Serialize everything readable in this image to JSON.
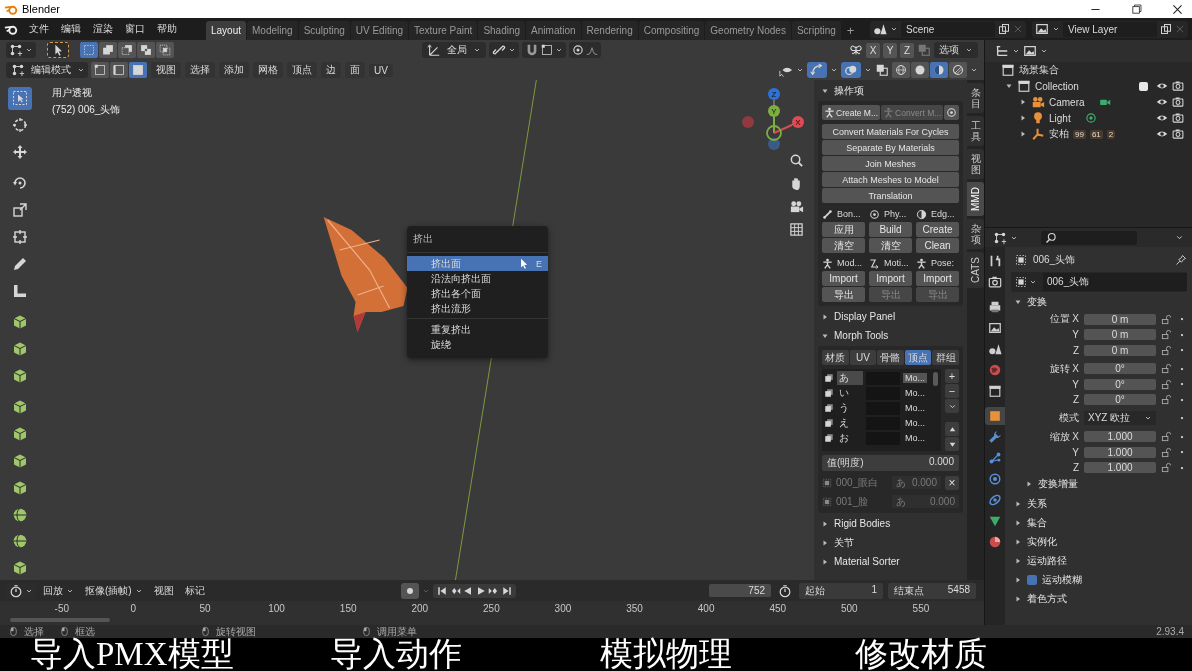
{
  "window": {
    "title": "Blender"
  },
  "menus": [
    "文件",
    "编辑",
    "渲染",
    "窗口",
    "帮助"
  ],
  "workspaces": [
    {
      "label": "Layout",
      "selected": true
    },
    {
      "label": "Modeling",
      "selected": false
    },
    {
      "label": "Sculpting",
      "selected": false
    },
    {
      "label": "UV Editing",
      "selected": false
    },
    {
      "label": "Texture Paint",
      "selected": false
    },
    {
      "label": "Shading",
      "selected": false
    },
    {
      "label": "Animation",
      "selected": false
    },
    {
      "label": "Rendering",
      "selected": false
    },
    {
      "label": "Compositing",
      "selected": false
    },
    {
      "label": "Geometry Nodes",
      "selected": false
    },
    {
      "label": "Scripting",
      "selected": false
    }
  ],
  "add_workspace": "+",
  "scene": "Scene",
  "view_layer": "View Layer",
  "viewport": {
    "select_set": [
      {
        "selected": true
      },
      {
        "selected": false
      },
      {
        "selected": false
      },
      {
        "selected": false
      },
      {
        "selected": false
      }
    ],
    "transform_orientation": "全局",
    "axes": [
      {
        "label": "X"
      },
      {
        "label": "Y"
      },
      {
        "label": "Z"
      }
    ],
    "options": "选项",
    "mode": "编辑模式",
    "select_modes": [
      {
        "selected": false
      },
      {
        "selected": false
      },
      {
        "selected": true
      }
    ],
    "menus": [
      "视图",
      "选择",
      "添加",
      "网格",
      "顶点",
      "边",
      "面",
      "UV"
    ],
    "shading": [
      {
        "selected": false
      },
      {
        "selected": false
      },
      {
        "selected": true
      },
      {
        "selected": false
      }
    ],
    "view_name": "用户透视",
    "object_info": "(752) 006_头饰",
    "gizmo": {
      "x": "X",
      "y": "Y",
      "z": "Z"
    }
  },
  "tools": [
    {
      "selected": true
    },
    {
      "selected": false
    },
    {
      "selected": false
    },
    {
      "selected": false
    },
    {
      "selected": false
    },
    {
      "selected": false
    },
    {
      "selected": false
    },
    {
      "selected": false
    },
    {
      "selected": false
    },
    {
      "selected": false
    },
    {
      "selected": false
    },
    {
      "selected": false
    },
    {
      "selected": false
    },
    {
      "selected": false
    },
    {
      "selected": false
    },
    {
      "selected": false
    },
    {
      "selected": false
    },
    {
      "selected": false
    }
  ],
  "context_menu": {
    "title": "挤出",
    "groups": [
      [
        {
          "label": "挤出面",
          "shortcut": "E",
          "selected": true
        },
        {
          "label": "沿法向挤出面",
          "selected": false
        },
        {
          "label": "挤出各个面",
          "selected": false
        },
        {
          "label": "挤出流形",
          "selected": false
        }
      ],
      [
        {
          "label": "重复挤出",
          "selected": false
        },
        {
          "label": "旋绕",
          "selected": false
        }
      ]
    ]
  },
  "sidebar": {
    "tabs": [
      {
        "label": "条目",
        "kind": "cjk",
        "selected": false
      },
      {
        "label": "工具",
        "kind": "cjk",
        "selected": false
      },
      {
        "label": "视图",
        "kind": "cjk",
        "selected": false
      },
      {
        "label": "MMD",
        "kind": "latin",
        "selected": true
      },
      {
        "label": "杂项",
        "kind": "cjk",
        "selected": false
      },
      {
        "label": "CATS",
        "kind": "latin",
        "selected": false
      }
    ],
    "operators": {
      "title": "操作项",
      "expanded": true,
      "top": [
        {
          "label": "Create M...",
          "disabled": false
        },
        {
          "label": "Convert M...",
          "disabled": true
        }
      ],
      "buttons": [
        "Convert Materials For Cycles",
        "Separate By Materials",
        "Join Meshes",
        "Attach Meshes to Model",
        "Translation"
      ],
      "groups": [
        {
          "title": "Bon...",
          "buttons": [
            {
              "label": "应用",
              "disabled": false
            },
            {
              "label": "清空",
              "disabled": false
            }
          ]
        },
        {
          "title": "Phy...",
          "buttons": [
            {
              "label": "Build",
              "disabled": false
            },
            {
              "label": "清空",
              "disabled": false
            }
          ]
        },
        {
          "title": "Edg...",
          "buttons": [
            {
              "label": "Create",
              "disabled": false
            },
            {
              "label": "Clean",
              "disabled": false
            }
          ]
        },
        {
          "title": "Mod...",
          "buttons": [
            {
              "label": "Import",
              "disabled": false
            },
            {
              "label": "导出",
              "disabled": false
            }
          ]
        },
        {
          "title": "Moti...",
          "buttons": [
            {
              "label": "Import",
              "disabled": false
            },
            {
              "label": "导出",
              "disabled": true
            }
          ]
        },
        {
          "title": "Pose:",
          "buttons": [
            {
              "label": "Import",
              "disabled": false
            },
            {
              "label": "导出",
              "disabled": true
            }
          ]
        }
      ]
    },
    "display_panel": {
      "title": "Display Panel",
      "expanded": false
    },
    "morph_tools": {
      "title": "Morph Tools",
      "expanded": true,
      "tabs": [
        {
          "label": "材质",
          "selected": false
        },
        {
          "label": "UV",
          "selected": false
        },
        {
          "label": "骨骼",
          "selected": false
        },
        {
          "label": "顶点",
          "selected": true
        },
        {
          "label": "群组",
          "selected": false
        }
      ],
      "rows": [
        {
          "label": "あ",
          "type": "Mo...",
          "selected": true
        },
        {
          "label": "い",
          "type": "Mo...",
          "selected": false
        },
        {
          "label": "う",
          "type": "Mo...",
          "selected": false
        },
        {
          "label": "え",
          "type": "Mo...",
          "selected": false
        },
        {
          "label": "お",
          "type": "Mo...",
          "selected": false
        }
      ],
      "add": "+",
      "remove": "−",
      "value_label": "值(明度)",
      "value": "0.000",
      "items": [
        {
          "name": "000_眼白",
          "morph": "あ",
          "value": "0.000",
          "disabled": true
        },
        {
          "name": "001_脸",
          "morph": "あ",
          "value": "0.000",
          "disabled": true
        }
      ],
      "clear": "×"
    },
    "bottom_panels": [
      {
        "title": "Rigid Bodies",
        "expanded": false
      },
      {
        "title": "关节",
        "expanded": false
      },
      {
        "title": "Material Sorter",
        "expanded": false
      }
    ]
  },
  "timeline": {
    "menus": [
      {
        "label": "回放",
        "kind": "dropdown"
      },
      {
        "label": "抠像(插帧)",
        "kind": "dropdown"
      },
      {
        "label": "视图",
        "kind": "menu"
      },
      {
        "label": "标记",
        "kind": "menu"
      }
    ],
    "current_frame": "752",
    "start_label": "起始",
    "start": "1",
    "end_label": "结束点",
    "end": "5458",
    "ruler": [
      "-50",
      "0",
      "50",
      "100",
      "150",
      "200",
      "250",
      "300",
      "350",
      "400",
      "450",
      "500",
      "550"
    ]
  },
  "outliner": {
    "root": "场景集合",
    "tree": [
      {
        "label": "Collection",
        "expanded": true,
        "checked": true,
        "children": [
          {
            "label": "Camera",
            "kind": "camera",
            "expanded": false
          },
          {
            "label": "Light",
            "kind": "light",
            "expanded": false
          },
          {
            "label": "安柏",
            "kind": "armature",
            "expanded": false,
            "badges": [
              "99",
              "61",
              "2"
            ]
          }
        ]
      }
    ]
  },
  "properties": {
    "tabs": [
      {
        "selected": false
      },
      {
        "selected": false
      },
      {
        "selected": false
      },
      {
        "selected": false
      },
      {
        "selected": false
      },
      {
        "selected": false
      },
      {
        "selected": false
      },
      {
        "selected": true
      },
      {
        "selected": false
      },
      {
        "selected": false
      },
      {
        "selected": false
      },
      {
        "selected": false
      },
      {
        "selected": false
      },
      {
        "selected": false
      }
    ],
    "object": "006_头饰",
    "name": "006_头饰",
    "transform": {
      "title": "变换",
      "expanded": true,
      "rows": [
        {
          "label": "位置 X",
          "value": "0 m",
          "kind": "number"
        },
        {
          "label": "Y",
          "value": "0 m",
          "kind": "number"
        },
        {
          "label": "Z",
          "value": "0 m",
          "kind": "number"
        },
        {
          "label": "旋转 X",
          "value": "0°",
          "kind": "number"
        },
        {
          "label": "Y",
          "value": "0°",
          "kind": "number"
        },
        {
          "label": "Z",
          "value": "0°",
          "kind": "number"
        },
        {
          "label": "模式",
          "value": "XYZ 欧拉",
          "kind": "dropdown"
        },
        {
          "label": "缩放 X",
          "value": "1.000",
          "kind": "number"
        },
        {
          "label": "Y",
          "value": "1.000",
          "kind": "number"
        },
        {
          "label": "Z",
          "value": "1.000",
          "kind": "number"
        }
      ],
      "subpanel": {
        "title": "变换增量",
        "expanded": false
      }
    },
    "panels": [
      {
        "title": "关系",
        "expanded": false
      },
      {
        "title": "集合",
        "expanded": false
      },
      {
        "title": "实例化",
        "expanded": false
      },
      {
        "title": "运动路径",
        "expanded": false
      },
      {
        "title": "运动模糊",
        "expanded": false,
        "kind": "toggle",
        "checked": true
      },
      {
        "title": "着色方式",
        "expanded": false
      }
    ]
  },
  "status_bar": {
    "hints": [
      "选择",
      "框选",
      "旋转视图",
      "调用菜单"
    ],
    "version": "2.93.4"
  },
  "subtitles": [
    "导入PMX模型",
    "导入动作",
    "模拟物理",
    "修改材质"
  ]
}
